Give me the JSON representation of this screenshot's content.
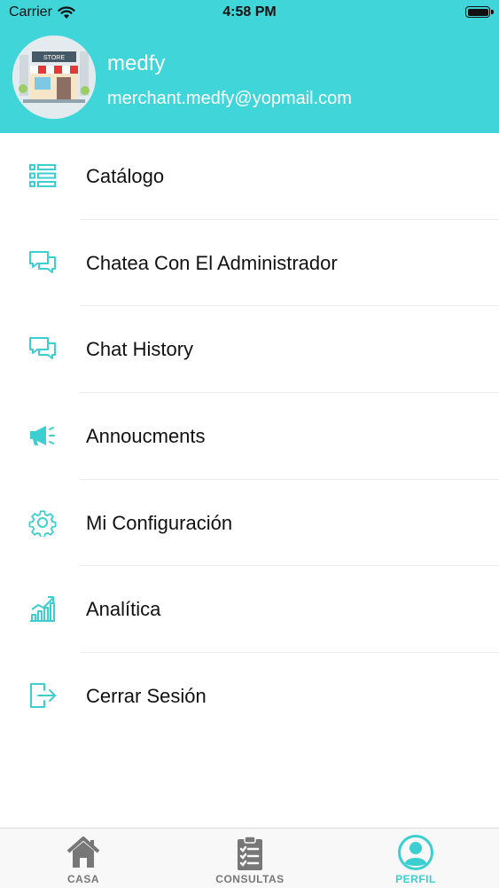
{
  "status_bar": {
    "carrier": "Carrier",
    "time": "4:58 PM"
  },
  "profile": {
    "name": "medfy",
    "email": "merchant.medfy@yopmail.com",
    "store_sign": "STORE"
  },
  "menu": {
    "items": [
      {
        "label": "Catálogo",
        "icon": "list-icon"
      },
      {
        "label": "Chatea Con El Administrador",
        "icon": "chat-icon"
      },
      {
        "label": "Chat History",
        "icon": "chat-history-icon"
      },
      {
        "label": "Annoucments",
        "icon": "megaphone-icon"
      },
      {
        "label": "Mi Configuración",
        "icon": "gear-icon"
      },
      {
        "label": "Analítica",
        "icon": "analytics-icon"
      },
      {
        "label": "Cerrar Sesión",
        "icon": "logout-icon"
      }
    ]
  },
  "tabbar": {
    "tabs": [
      {
        "label": "CASA",
        "icon": "home-icon"
      },
      {
        "label": "CONSULTAS",
        "icon": "clipboard-icon"
      },
      {
        "label": "PERFIL",
        "icon": "profile-icon",
        "active": true
      }
    ]
  },
  "colors": {
    "accent": "#40d6d9",
    "icon": "#3ccfd2",
    "tab_inactive": "#777777",
    "text": "#111111"
  }
}
